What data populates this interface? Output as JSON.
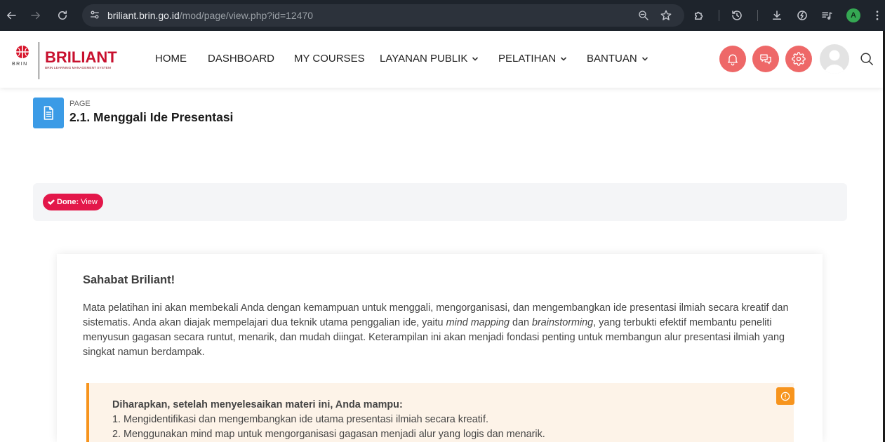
{
  "browser": {
    "url_host": "briliant.brin.go.id",
    "url_path": "/mod/page/view.php?id=12470",
    "profile_initial": "A",
    "toolbar_icons": [
      "back-icon",
      "forward-icon",
      "reload-icon",
      "site-settings-icon",
      "zoom-out-icon",
      "bookmark-star-icon",
      "extensions-icon",
      "history-icon",
      "download-icon",
      "performance-icon",
      "media-control-icon",
      "menu-kebab-icon"
    ]
  },
  "site": {
    "org_logo_text": "BRIN",
    "brand": "BRILIANT",
    "brand_tagline": "BRIN LEARNING MANAGEMENT SYSTEM",
    "nav": [
      {
        "label": "HOME",
        "dropdown": false
      },
      {
        "label": "DASHBOARD",
        "dropdown": false
      },
      {
        "label": "MY COURSES",
        "dropdown": false
      },
      {
        "label": "LAYANAN PUBLIK",
        "dropdown": true
      },
      {
        "label": "PELATIHAN",
        "dropdown": true
      },
      {
        "label": "BANTUAN",
        "dropdown": true
      }
    ],
    "actions": [
      {
        "icon": "bell-icon"
      },
      {
        "icon": "chat-icon"
      },
      {
        "icon": "gear-icon"
      }
    ],
    "user_icon": "user-avatar-icon",
    "search_icon": "search-icon"
  },
  "page_header": {
    "icon": "page-icon",
    "type_label": "PAGE",
    "title": "2.1. Menggali Ide Presentasi"
  },
  "completion": {
    "icon": "check-icon",
    "label": "Done:",
    "value": "View"
  },
  "content": {
    "heading": "Sahabat Briliant!",
    "intro": {
      "text_1": "Mata pelatihan ini akan membekali Anda dengan kemampuan untuk menggali, mengorganisasi, dan mengembangkan ide presentasi ilmiah secara kreatif dan sistematis. Anda akan diajak mempelajari dua teknik utama penggalian ide, yaitu ",
      "emphasis_1": "mind mapping",
      "text_2": " dan ",
      "emphasis_2": "brainstorming",
      "text_3": ", yang terbukti efektif membantu peneliti menyusun gagasan secara runtut, menarik, dan mudah diingat. Keterampilan ini akan menjadi fondasi penting untuk membangun alur presentasi ilmiah yang singkat namun berdampak."
    },
    "objectives": {
      "icon": "alert-circle-icon",
      "title": "Diharapkan, setelah menyelesaikan materi ini, Anda mampu:",
      "items": [
        "1. Mengidentifikasi dan mengembangkan ide utama presentasi ilmiah secara kreatif.",
        "2. Menggunakan mind map untuk mengorganisasi gagasan menjadi alur yang logis dan menarik."
      ]
    }
  },
  "colors": {
    "brand": "#c8102e",
    "action_bg": "#ee6868",
    "done_bg": "#e3174a",
    "page_icon_bg": "#3b9be6",
    "callout_border": "#f7941d",
    "callout_bg": "#fdf3e8",
    "chrome_bg": "#1e242c",
    "omnibox_bg": "#2c323b",
    "profile_bg": "#35a853",
    "completion_bg": "#f4f5f7"
  }
}
